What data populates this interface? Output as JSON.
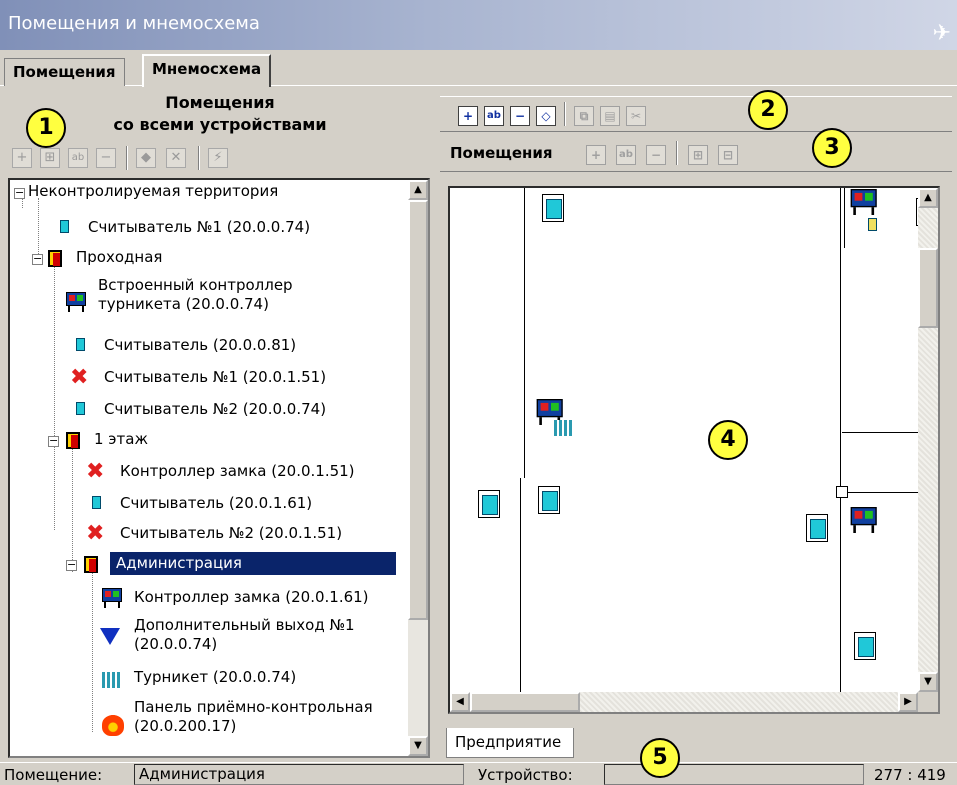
{
  "window": {
    "title": "Помещения и мнемосхема"
  },
  "tabs": [
    {
      "label": "Помещения"
    },
    {
      "label": "Мнемосхема"
    }
  ],
  "left_panel": {
    "header_line1": "Помещения",
    "header_line2": "со всеми устройствами",
    "tree": [
      {
        "label": "Неконтролируемая территория",
        "icon": "expand-icon"
      },
      {
        "label": "Считыватель №1 (20.0.0.74)",
        "icon": "reader-icon"
      },
      {
        "label": "Проходная",
        "icon": "door-icon"
      },
      {
        "label": "Встроенный контроллер\nтурникета (20.0.0.74)",
        "label1": "Встроенный контроллер",
        "label2": "турникета (20.0.0.74)",
        "icon": "controller-icon"
      },
      {
        "label": "Считыватель (20.0.0.81)",
        "icon": "reader-icon"
      },
      {
        "label": "Считыватель №1 (20.0.1.51)",
        "icon": "error-icon"
      },
      {
        "label": "Считыватель №2 (20.0.0.74)",
        "icon": "reader-icon"
      },
      {
        "label": "1 этаж",
        "icon": "door-icon"
      },
      {
        "label": "Контроллер замка (20.0.1.51)",
        "icon": "error-icon"
      },
      {
        "label": "Считыватель (20.0.1.61)",
        "icon": "reader-icon"
      },
      {
        "label": "Считыватель №2 (20.0.1.51)",
        "icon": "error-icon"
      },
      {
        "label": "Администрация",
        "icon": "door-icon",
        "selected": true
      },
      {
        "label": "Контроллер замка (20.0.1.61)",
        "icon": "controller-icon"
      },
      {
        "label1": "Дополнительный выход №1",
        "label2": "(20.0.0.74)",
        "icon": "output-icon"
      },
      {
        "label": "Турникет (20.0.0.74)",
        "icon": "turnstile-icon"
      },
      {
        "label1": "Панель приёмно-контрольная",
        "label2": "(20.0.200.17)",
        "icon": "fire-panel-icon"
      }
    ]
  },
  "right_panel": {
    "toolbar2_label": "Помещения",
    "sheet_tab": "Предприятие"
  },
  "status": {
    "room_label": "Помещение:",
    "room_value": "Администрация",
    "device_label": "Устройство:",
    "device_value": "",
    "coords": "277 : 419"
  },
  "callouts": [
    "1",
    "2",
    "3",
    "4",
    "5"
  ]
}
